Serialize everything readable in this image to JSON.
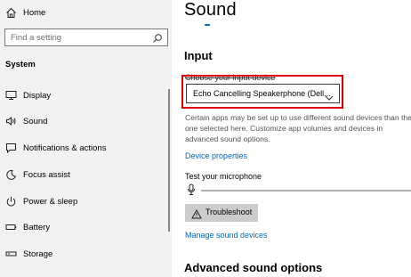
{
  "sidebar": {
    "home_label": "Home",
    "search_placeholder": "Find a setting",
    "section_title": "System",
    "items": [
      {
        "label": "Display",
        "icon": "monitor-icon"
      },
      {
        "label": "Sound",
        "icon": "speaker-icon"
      },
      {
        "label": "Notifications & actions",
        "icon": "notification-icon"
      },
      {
        "label": "Focus assist",
        "icon": "moon-icon"
      },
      {
        "label": "Power & sleep",
        "icon": "power-icon"
      },
      {
        "label": "Battery",
        "icon": "battery-icon"
      },
      {
        "label": "Storage",
        "icon": "storage-icon"
      }
    ]
  },
  "main": {
    "title": "Sound",
    "input_heading": "Input",
    "choose_label": "Choose your input device",
    "device_value": "Echo Cancelling Speakerphone (Dell...",
    "description": "Certain apps may be set up to use different sound devices than the one selected here. Customize app volumes and devices in advanced sound options.",
    "device_properties_link": "Device properties",
    "test_mic_label": "Test your microphone",
    "troubleshoot_label": "Troubleshoot",
    "manage_devices_link": "Manage sound devices",
    "advanced_heading": "Advanced sound options"
  },
  "colors": {
    "accent": "#0067c0",
    "highlight": "#e00000",
    "sidebar_bg": "#f2f2f2"
  }
}
